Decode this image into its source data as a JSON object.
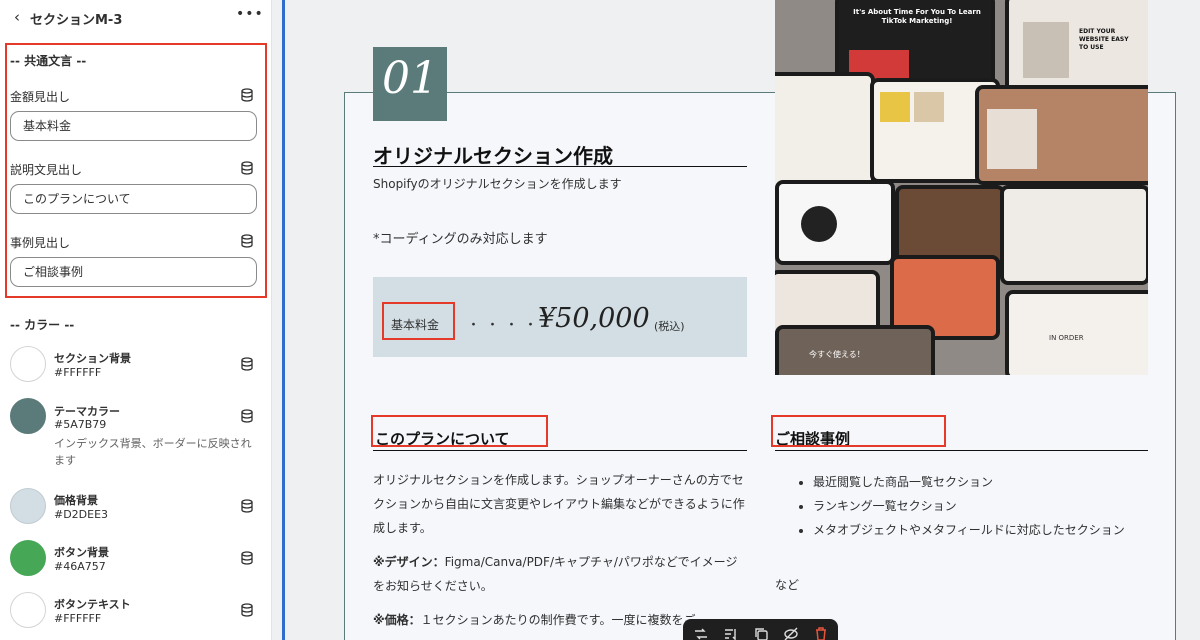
{
  "sidebar": {
    "title": "セクションM-3",
    "back_glyph": "‹",
    "more_glyph": "•••",
    "common_group_title": "-- 共通文言 --",
    "fields": [
      {
        "label": "金額見出し",
        "value": "基本料金"
      },
      {
        "label": "説明文見出し",
        "value": "このプランについて"
      },
      {
        "label": "事例見出し",
        "value": "ご相談事例"
      }
    ],
    "color_group_title": "-- カラー --",
    "colors": [
      {
        "name": "セクション背景",
        "hex": "#FFFFFF",
        "desc": ""
      },
      {
        "name": "テーマカラー",
        "hex": "#5A7B79",
        "desc": "インデックス背景、ボーダーに反映されます"
      },
      {
        "name": "価格背景",
        "hex": "#D2DEE3",
        "desc": ""
      },
      {
        "name": "ボタン背景",
        "hex": "#46A757",
        "desc": ""
      },
      {
        "name": "ボタンテキスト",
        "hex": "#FFFFFF",
        "desc": ""
      }
    ]
  },
  "preview": {
    "number": "01",
    "title": "オリジナルセクション作成",
    "subtitle": "Shopifyのオリジナルセクションを作成します",
    "note": "*コーディングのみ対応します",
    "price_label": "基本料金",
    "price_dots": "・・・・",
    "price": "¥50,000",
    "tax": "(税込)",
    "about_heading": "このプランについて",
    "about_text": "オリジナルセクションを作成します。ショップオーナーさんの方でセクションから自由に文言変更やレイアウト編集などができるように作成します。",
    "design_label": "※デザイン：",
    "design_text": "Figma/Canva/PDF/キャプチャ/パワポなどでイメージをお知らせください。",
    "price_note_label": "※価格：",
    "price_note_text": "１セクションあたりの制作費です。一度に複数をご",
    "cases_heading": "ご相談事例",
    "cases": [
      "最近閲覧した商品一覧セクション",
      "ランキング一覧セクション",
      "メタオブジェクトやメタフィールドに対応したセクション"
    ],
    "cases_suffix": "など"
  },
  "collage": {
    "tiles": [
      {
        "caption": "It's About Time For You To Learn TikTok Marketing!"
      },
      {
        "caption": "EDIT YOUR WEBSITE EASY TO USE"
      },
      {
        "caption": "今すぐ使える！"
      },
      {
        "caption": "IN ORDER"
      }
    ]
  },
  "toolbar": {
    "icons": [
      "move-icon",
      "sort-icon",
      "duplicate-icon",
      "hide-icon",
      "delete-icon"
    ]
  },
  "colors": {
    "accent_red": "#E53929",
    "theme": "#5A7B79",
    "price_bg": "#D2DEE3",
    "button_bg": "#46A757",
    "preview_border_blue": "#2C6ECB"
  }
}
